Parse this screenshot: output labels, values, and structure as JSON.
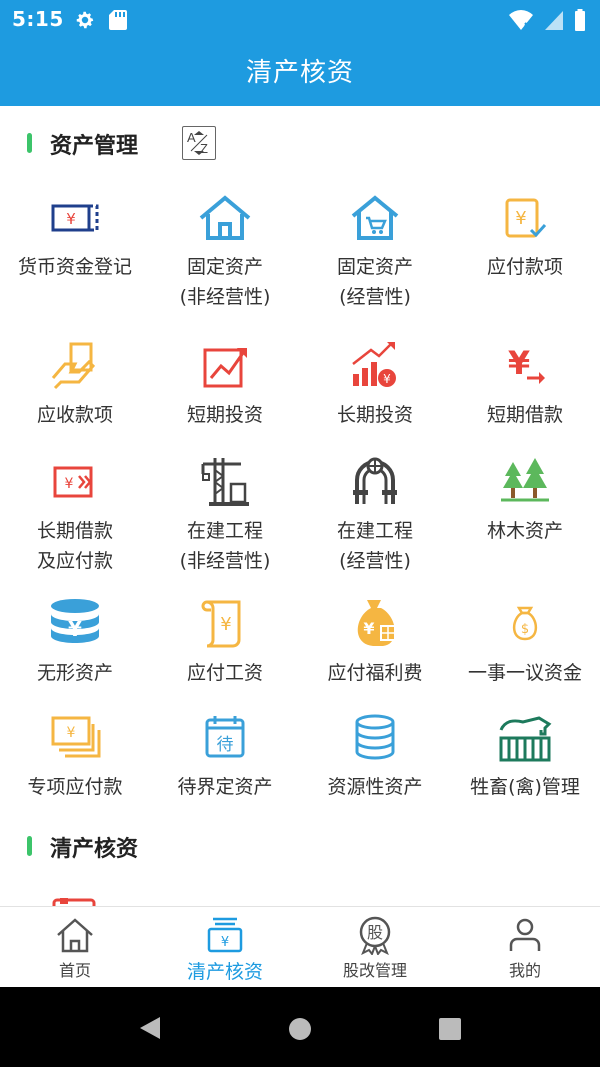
{
  "status": {
    "time": "5:15"
  },
  "app": {
    "title": "清产核资"
  },
  "sections": {
    "asset_management": {
      "title": "资产管理",
      "sort_a": "A",
      "sort_z": "Z"
    },
    "inventory": {
      "title": "清产核资"
    }
  },
  "tiles": [
    {
      "line1": "货币资金登记",
      "line2": "",
      "icon": "banknote-icon"
    },
    {
      "line1": "固定资产",
      "line2": "(非经营性)",
      "icon": "house-icon"
    },
    {
      "line1": "固定资产",
      "line2": "(经营性)",
      "icon": "shop-house-icon"
    },
    {
      "line1": "应付款项",
      "line2": "",
      "icon": "payable-check-icon"
    },
    {
      "line1": "应收款项",
      "line2": "",
      "icon": "receivable-hand-icon"
    },
    {
      "line1": "短期投资",
      "line2": "",
      "icon": "trend-chart-icon"
    },
    {
      "line1": "长期投资",
      "line2": "",
      "icon": "bar-growth-icon"
    },
    {
      "line1": "短期借款",
      "line2": "",
      "icon": "yuan-arrow-icon"
    },
    {
      "line1": "长期借款",
      "line2": "及应付款",
      "icon": "loan-card-icon"
    },
    {
      "line1": "在建工程",
      "line2": "(非经营性)",
      "icon": "crane-icon"
    },
    {
      "line1": "在建工程",
      "line2": "(经营性)",
      "icon": "arch-pipe-icon"
    },
    {
      "line1": "林木资产",
      "line2": "",
      "icon": "trees-icon"
    },
    {
      "line1": "无形资产",
      "line2": "",
      "icon": "coin-stack-icon"
    },
    {
      "line1": "应付工资",
      "line2": "",
      "icon": "scroll-yuan-icon"
    },
    {
      "line1": "应付福利费",
      "line2": "",
      "icon": "money-bag-gift-icon"
    },
    {
      "line1": "一事一议资金",
      "line2": "",
      "icon": "money-bag-icon"
    },
    {
      "line1": "专项应付款",
      "line2": "",
      "icon": "stacked-cards-icon"
    },
    {
      "line1": "待界定资产",
      "line2": "",
      "icon": "calendar-pending-icon"
    },
    {
      "line1": "资源性资产",
      "line2": "",
      "icon": "database-icon"
    },
    {
      "line1": "牲畜(禽)管理",
      "line2": "",
      "icon": "livestock-barn-icon"
    }
  ],
  "nav": [
    {
      "label": "首页",
      "icon": "home-icon",
      "active": false
    },
    {
      "label": "清产核资",
      "icon": "cash-register-icon",
      "active": true
    },
    {
      "label": "股改管理",
      "icon": "share-badge-icon",
      "active": false,
      "badge_text": "股"
    },
    {
      "label": "我的",
      "icon": "user-icon",
      "active": false
    }
  ],
  "colors": {
    "primary": "#1e9be0",
    "accent_green": "#3cc46a",
    "orange": "#f5b642",
    "red": "#e8453c",
    "navy": "#1f3f8c",
    "forest": "#1d7a5c"
  }
}
